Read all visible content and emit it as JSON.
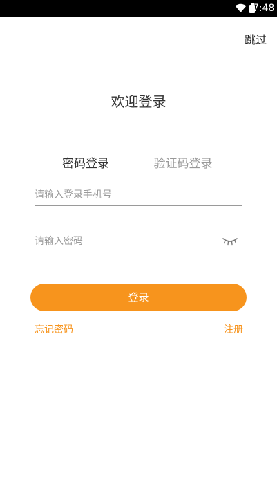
{
  "status_bar": {
    "time": "7:48",
    "wifi_icon": "wifi-icon",
    "battery_icon": "battery-icon"
  },
  "header": {
    "skip_label": "跳过"
  },
  "title": "欢迎登录",
  "tabs": [
    {
      "label": "密码登录",
      "active": true
    },
    {
      "label": "验证码登录",
      "active": false
    }
  ],
  "phone_input": {
    "placeholder": "请输入登录手机号",
    "value": ""
  },
  "password_input": {
    "placeholder": "请输入密码",
    "value": "",
    "toggle_icon": "eye-closed-icon"
  },
  "login_button": {
    "label": "登录"
  },
  "links": {
    "forgot_password": "忘记密码",
    "register": "注册"
  },
  "colors": {
    "accent": "#f7941d",
    "text_primary": "#333333",
    "text_secondary": "#999999",
    "divider": "#9a9a9a",
    "status_bar": "#000000"
  }
}
